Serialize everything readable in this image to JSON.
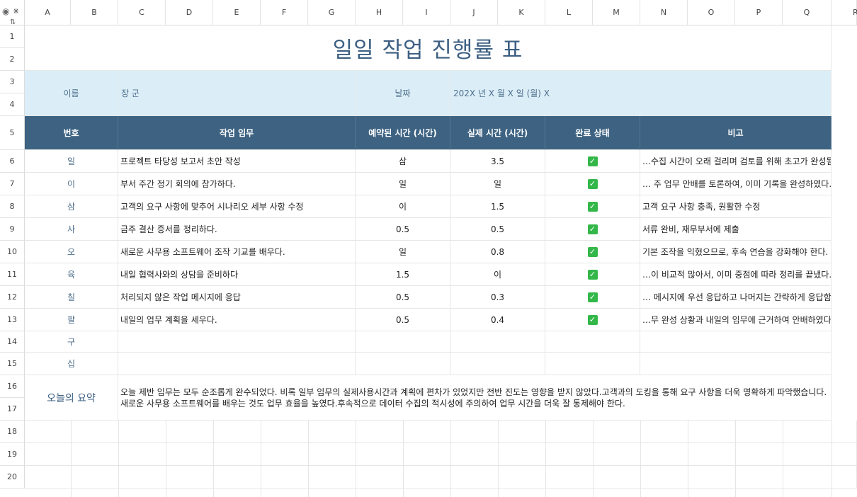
{
  "columns": [
    "A",
    "B",
    "C",
    "D",
    "E",
    "F",
    "G",
    "H",
    "I",
    "J",
    "K",
    "L",
    "M",
    "N",
    "O",
    "P",
    "Q",
    "R"
  ],
  "rows": [
    "1",
    "2",
    "3",
    "4",
    "5",
    "6",
    "7",
    "8",
    "9",
    "10",
    "11",
    "12",
    "13",
    "14",
    "15",
    "16",
    "17",
    "18",
    "19",
    "20"
  ],
  "title": "일일 작업 진행률 표",
  "info": {
    "name_label": "이름",
    "name_value": "장 군",
    "date_label": "날짜",
    "date_value": "202X 년 X 월 X 일 (월) X"
  },
  "headers": {
    "no": "번호",
    "task": "작업 임무",
    "planned": "예약된 시간 (시간)",
    "actual": "실제 시간 (시간)",
    "status": "완료 상태",
    "note": "비고"
  },
  "tasks": [
    {
      "no": "일",
      "task": "프로젝트 타당성 보고서 초안 작성",
      "planned": "삼",
      "actual": "3.5",
      "status": "✓",
      "note": "…수집 시간이 오래 걸리며 검토를 위해 초고가 완성됨"
    },
    {
      "no": "이",
      "task": "부서 주간 정기 회의에 참가하다.",
      "planned": "일",
      "actual": "일",
      "status": "✓",
      "note": "… 주 업무 안배를 토론하여, 이미 기록을 완성하였다."
    },
    {
      "no": "삼",
      "task": "고객의 요구 사항에 맞추어 시나리오 세부 사항 수정",
      "planned": "이",
      "actual": "1.5",
      "status": "✓",
      "note": "고객 요구 사항 충족, 원활한 수정"
    },
    {
      "no": "사",
      "task": "금주 결산 증서를 정리하다.",
      "planned": "0.5",
      "actual": "0.5",
      "status": "✓",
      "note": "서류 완비, 재무부서에 제출"
    },
    {
      "no": "오",
      "task": "새로운 사무용 소프트웨어 조작 기교를 배우다.",
      "planned": "일",
      "actual": "0.8",
      "status": "✓",
      "note": "기본 조작을 익혔으므로, 후속 연습을 강화해야 한다."
    },
    {
      "no": "육",
      "task": "내일 협력사와의 상담을 준비하다",
      "planned": "1.5",
      "actual": "이",
      "status": "✓",
      "note": "…이 비교적 많아서, 이미 중점에 따라 정리를 끝냈다."
    },
    {
      "no": "칠",
      "task": "처리되지 않은 작업 메시지에 응답",
      "planned": "0.5",
      "actual": "0.3",
      "status": "✓",
      "note": "… 메시지에 우선 응답하고 나머지는 간략하게 응답함"
    },
    {
      "no": "팔",
      "task": "내일의 업무 계획을 세우다.",
      "planned": "0.5",
      "actual": "0.4",
      "status": "✓",
      "note": "…무 완성 상황과 내일의 임무에 근거하여 안배하였다"
    },
    {
      "no": "구",
      "task": "",
      "planned": "",
      "actual": "",
      "status": "",
      "note": ""
    },
    {
      "no": "십",
      "task": "",
      "planned": "",
      "actual": "",
      "status": "",
      "note": ""
    }
  ],
  "summary": {
    "label": "오늘의 요약",
    "text": "오늘 제반 임무는 모두 순조롭게 완수되었다. 비록 일부 임무의 실제사용시간과 계획에 편차가 있었지만 전반 진도는 영향을 받지 않았다.고객과의 도킹을 통해 요구 사항을 더욱 명확하게 파악했습니다.새로운 사무용 소프트웨어를 배우는 것도 업무 효율을 높였다.후속적으로 데이터 수집의 적시성에 주의하여 업무 시간을 더욱 잘 통제해야 한다."
  },
  "corner": {
    "eye": "◉",
    "freeze": "⋇",
    "split": "⇅"
  }
}
